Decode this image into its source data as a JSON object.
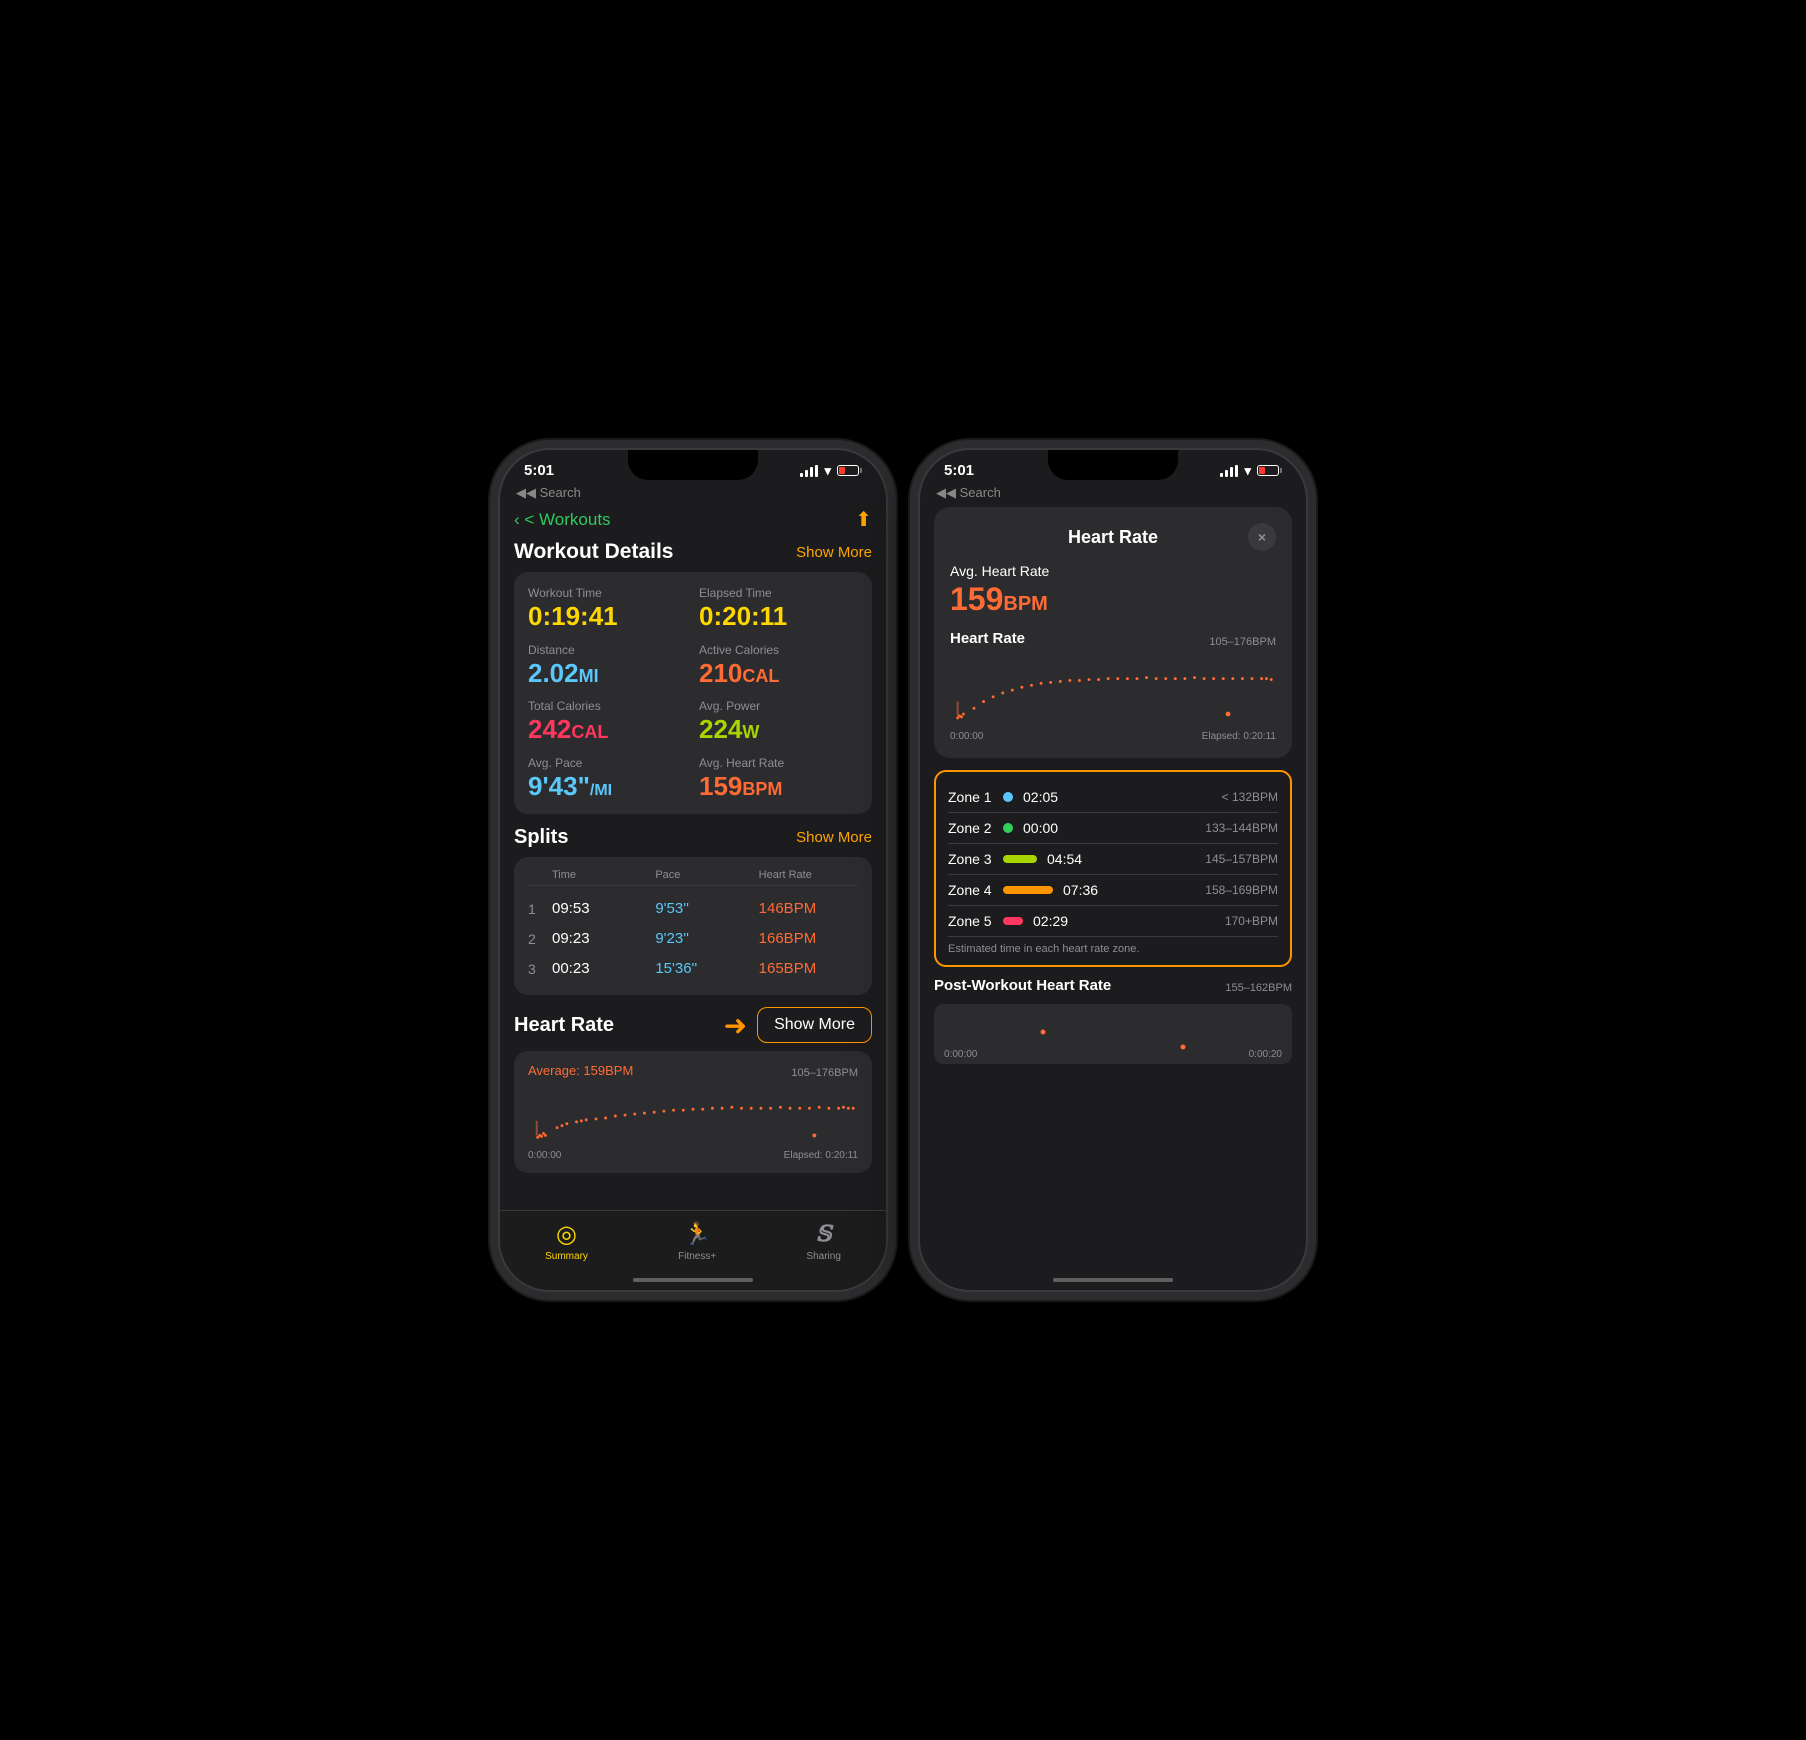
{
  "phone1": {
    "status": {
      "time": "5:01",
      "back_label": "◀ Search"
    },
    "header": {
      "back": "< Workouts",
      "title": "Workout Details",
      "show_more": "Show More",
      "share_icon": "↑"
    },
    "metrics": [
      {
        "label": "Workout Time",
        "value": "0:19:41",
        "color": "yellow"
      },
      {
        "label": "Elapsed Time",
        "value": "0:20:11",
        "color": "yellow"
      },
      {
        "label": "Distance",
        "value": "2.02",
        "unit": "MI",
        "color": "teal"
      },
      {
        "label": "Active Calories",
        "value": "210",
        "unit": "CAL",
        "color": "red-orange"
      },
      {
        "label": "Total Calories",
        "value": "242",
        "unit": "CAL",
        "color": "pink"
      },
      {
        "label": "Avg. Power",
        "value": "224",
        "unit": "W",
        "color": "green-yellow"
      },
      {
        "label": "Avg. Pace",
        "value": "9'43\"",
        "unit": "/MI",
        "color": "teal"
      },
      {
        "label": "Avg. Heart Rate",
        "value": "159",
        "unit": "BPM",
        "color": "red-orange"
      }
    ],
    "splits": {
      "title": "Splits",
      "show_more": "Show More",
      "columns": [
        "",
        "Time",
        "Pace",
        "Heart Rate"
      ],
      "rows": [
        {
          "num": "1",
          "time": "09:53",
          "pace": "9'53''",
          "hr": "146BPM"
        },
        {
          "num": "2",
          "time": "09:23",
          "pace": "9'23''",
          "hr": "166BPM"
        },
        {
          "num": "3",
          "time": "00:23",
          "pace": "15'36''",
          "hr": "165BPM"
        }
      ]
    },
    "heart_rate": {
      "title": "Heart Rate",
      "show_more": "Show More",
      "avg_label": "Average: 159BPM",
      "range": "105–176BPM",
      "time_start": "0:00:00",
      "time_end": "Elapsed: 0:20:11"
    },
    "tabs": [
      {
        "label": "Summary",
        "active": true
      },
      {
        "label": "Fitness+",
        "active": false
      },
      {
        "label": "Sharing",
        "active": false
      }
    ]
  },
  "phone2": {
    "status": {
      "time": "5:01",
      "back_label": "◀ Search"
    },
    "modal": {
      "title": "Heart Rate",
      "close": "×",
      "avg_label": "Avg. Heart Rate",
      "avg_value": "159",
      "avg_unit": "BPM",
      "chart_label": "Heart Rate",
      "chart_range": "105–176BPM",
      "time_start": "0:00:00",
      "time_elapsed": "Elapsed: 0:20:11",
      "zones": [
        {
          "name": "Zone 1",
          "color": "#5ac8fa",
          "type": "dot",
          "time": "02:05",
          "range": "< 132BPM"
        },
        {
          "name": "Zone 2",
          "color": "#30d158",
          "type": "dot",
          "time": "00:00",
          "range": "133–144BPM"
        },
        {
          "name": "Zone 3",
          "color": "#a8d400",
          "type": "bar",
          "time": "04:54",
          "range": "145–157BPM"
        },
        {
          "name": "Zone 4",
          "color": "#ff9500",
          "type": "bar",
          "time": "07:36",
          "range": "158–169BPM"
        },
        {
          "name": "Zone 5",
          "color": "#ff375f",
          "type": "bar",
          "time": "02:29",
          "range": "170+BPM"
        }
      ],
      "zone_note": "Estimated time in each heart rate zone.",
      "post_title": "Post-Workout Heart Rate",
      "post_range": "155–162BPM",
      "post_time_start": "0:00:00",
      "post_time_end": "0:00:20"
    }
  },
  "icons": {
    "summary": "◎",
    "fitness_plus": "🏃",
    "sharing": "S",
    "share": "⬆",
    "back": "‹"
  }
}
